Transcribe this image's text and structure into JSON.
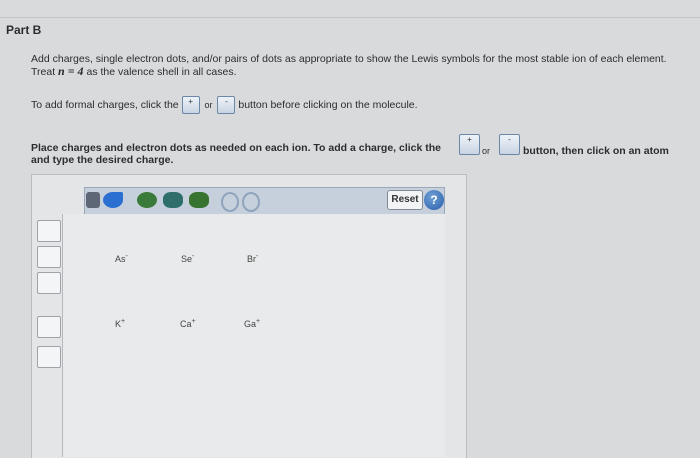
{
  "part": {
    "title": "Part B"
  },
  "instructions": {
    "line1": "Add charges, single electron dots, and/or pairs of dots as appropriate to show the Lewis symbols for the most stable ion of each element.",
    "line2_prefix": "Treat",
    "line2_math": "n = 4",
    "line2_suffix": "as the valence shell in all cases.",
    "formal_before": "To add formal charges, click the",
    "formal_or": "or",
    "formal_after": "button before clicking on the molecule.",
    "place_line1": "Place charges and electron dots as needed on each ion. To add a charge, click the",
    "place_or": "or",
    "place_after": "button, then click on an atom",
    "place_line2": "and type the desired charge."
  },
  "buttons": {
    "plus_symbol": "+",
    "minus_symbol": "-"
  },
  "toolbar": {
    "reset_label": "Reset",
    "help_label": "?"
  },
  "ions": [
    {
      "symbol": "As",
      "charge": "-"
    },
    {
      "symbol": "Se",
      "charge": "-"
    },
    {
      "symbol": "Br",
      "charge": "-"
    },
    {
      "symbol": "K",
      "charge": "+"
    },
    {
      "symbol": "Ca",
      "charge": "+"
    },
    {
      "symbol": "Ga",
      "charge": "+"
    }
  ],
  "icons": [
    "select-icon",
    "eraser-icon",
    "rotate-icon",
    "chain-icon",
    "group-icon",
    "undo-icon",
    "redo-icon",
    "single-bond-icon",
    "double-bond-icon",
    "triple-bond-icon",
    "lone-pair-dot-icon",
    "dots-icon"
  ]
}
